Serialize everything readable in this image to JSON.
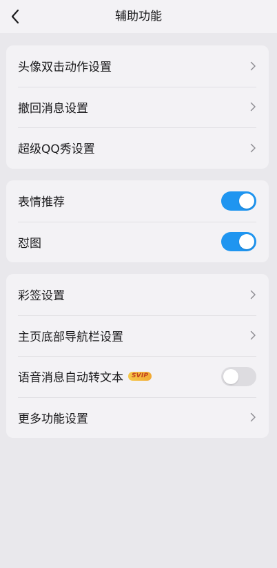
{
  "header": {
    "title": "辅助功能",
    "back_icon": "chevron-left-icon"
  },
  "group1": {
    "items": [
      {
        "label": "头像双击动作设置"
      },
      {
        "label": "撤回消息设置"
      },
      {
        "label": "超级QQ秀设置"
      }
    ]
  },
  "group2": {
    "items": [
      {
        "label": "表情推荐",
        "toggle": "on"
      },
      {
        "label": "怼图",
        "toggle": "on"
      }
    ]
  },
  "group3": {
    "items": [
      {
        "label": "彩签设置"
      },
      {
        "label": "主页底部导航栏设置"
      },
      {
        "label": "语音消息自动转文本",
        "badge": "SVIP",
        "toggle": "off"
      },
      {
        "label": "更多功能设置"
      }
    ]
  },
  "colors": {
    "background": "#e9e8ec",
    "card": "#f3f2f5",
    "toggle_on": "#1f95f0",
    "toggle_off": "#dddce0",
    "badge": "#f6c94a"
  }
}
